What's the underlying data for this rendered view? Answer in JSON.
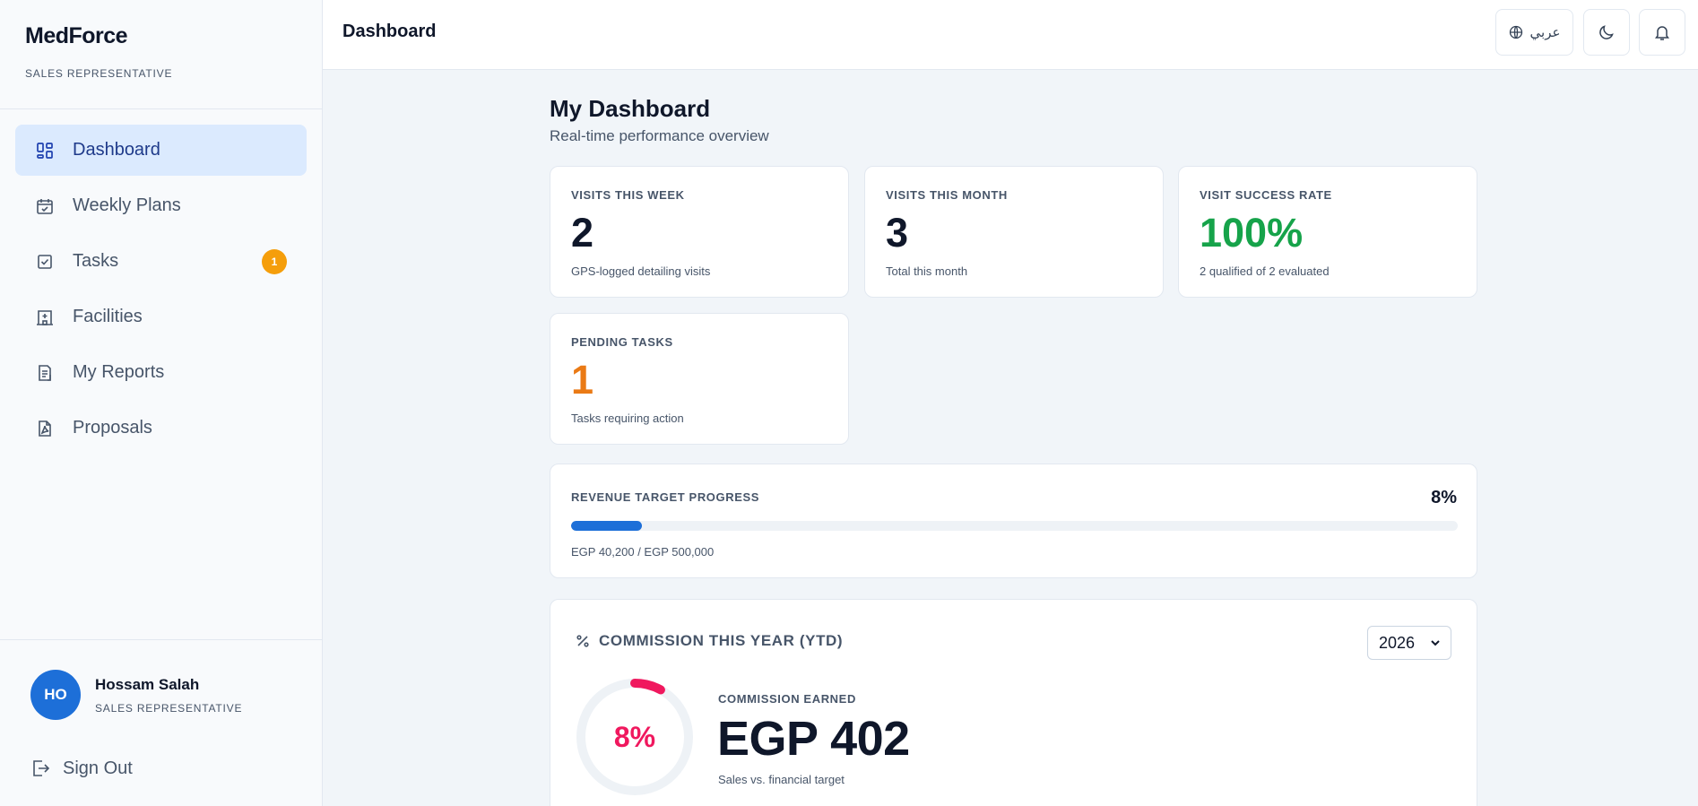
{
  "sidebar": {
    "brand": "MedForce",
    "role": "SALES REPRESENTATIVE",
    "items": [
      {
        "label": "Dashboard",
        "icon": "dashboard-icon",
        "active": true
      },
      {
        "label": "Weekly Plans",
        "icon": "calendar-check-icon"
      },
      {
        "label": "Tasks",
        "icon": "checkbox-icon",
        "badge": "1"
      },
      {
        "label": "Facilities",
        "icon": "hospital-building-icon"
      },
      {
        "label": "My Reports",
        "icon": "report-icon"
      },
      {
        "label": "Proposals",
        "icon": "pdf-document-icon"
      }
    ],
    "user": {
      "initials": "HO",
      "name": "Hossam Salah",
      "role": "SALES REPRESENTATIVE"
    },
    "sign_out": "Sign Out"
  },
  "topbar": {
    "title": "Dashboard",
    "language_label": "عربي"
  },
  "main": {
    "title": "My Dashboard",
    "subtitle": "Real-time performance overview",
    "stats": [
      {
        "key": "VISITS THIS WEEK",
        "value": "2",
        "desc": "GPS-logged detailing visits"
      },
      {
        "key": "VISITS THIS MONTH",
        "value": "3",
        "desc": "Total this month"
      },
      {
        "key": "VISIT SUCCESS RATE",
        "value": "100%",
        "desc": "2 qualified of 2 evaluated",
        "color": "#16a34a"
      },
      {
        "key": "PENDING TASKS",
        "value": "1",
        "desc": "Tasks requiring action",
        "color": "#ea7a15"
      }
    ],
    "revenue": {
      "label": "REVENUE TARGET PROGRESS",
      "percent_text": "8%",
      "progress": 0.08,
      "detail": "EGP 40,200 / EGP 500,000"
    },
    "commission": {
      "title": "COMMISSION THIS YEAR (YTD)",
      "year": "2026",
      "ring_text": "8%",
      "ring_progress": 0.08,
      "earned_label": "COMMISSION EARNED",
      "earned_value": "EGP 402",
      "desc": "Sales vs. financial target"
    }
  },
  "colors": {
    "accent": "#1d6fd8",
    "success": "#16a34a",
    "warning": "#f59e0b",
    "commission": "#f0185e"
  }
}
